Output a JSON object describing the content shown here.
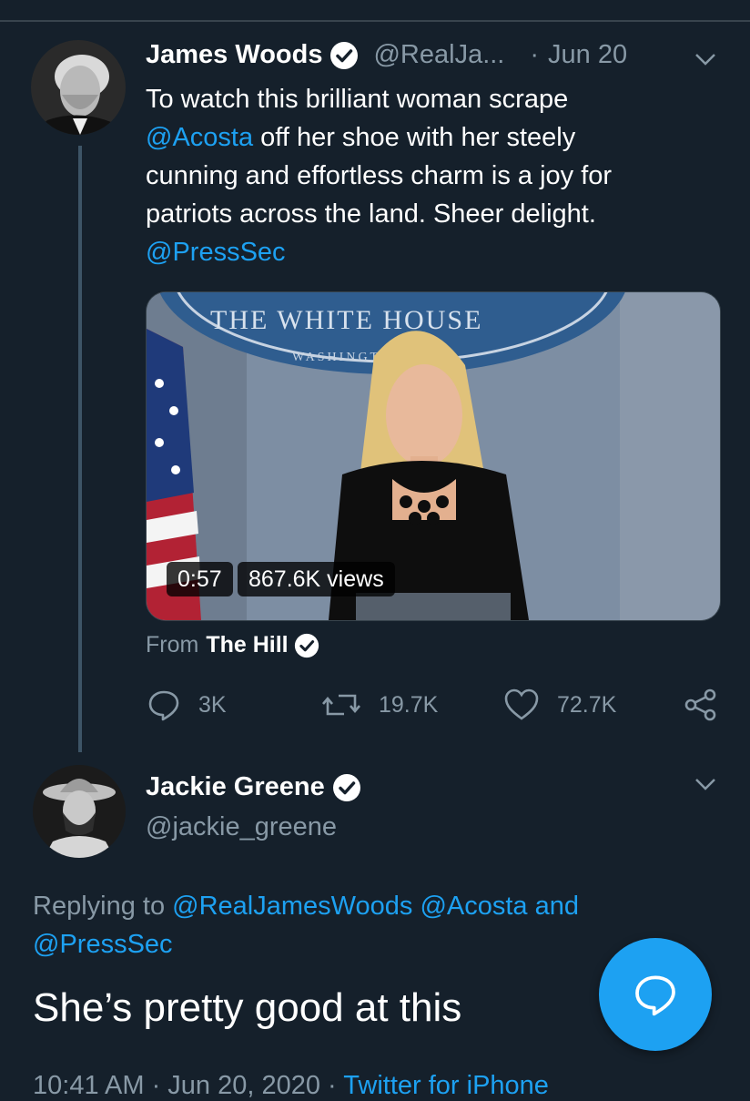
{
  "tweet": {
    "author_name": "James Woods",
    "author_handle": "@RealJa...",
    "separator": "·",
    "date": "Jun 20",
    "text_lines": [
      "To watch this brilliant woman scrape",
      " off her shoe with her steely",
      "cunning and effortless charm is a joy for",
      "patriots across the land. Sheer delight."
    ],
    "mention_acosta": "@Acosta",
    "mention_presssec": "@PressSec",
    "media": {
      "seal_text_top": "THE WHITE HOUSE",
      "seal_text_bottom": "WASHINGTON",
      "duration": "0:57",
      "views": "867.6K views"
    },
    "from_label": "From",
    "from_source": "The Hill",
    "actions": {
      "replies": "3K",
      "retweets": "19.7K",
      "likes": "72.7K"
    }
  },
  "reply": {
    "author_name": "Jackie Greene",
    "author_handle": "@jackie_greene",
    "replying_label": "Replying to",
    "replying_to_1": "@RealJamesWoods",
    "replying_to_2": "@Acosta",
    "replying_and": "and",
    "replying_to_3": "@PressSec",
    "text": "She’s pretty good at this",
    "meta_time": "10:41 AM · Jun 20, 2020 ·",
    "meta_source": "Twitter for iPhone"
  },
  "colors": {
    "background": "#15202b",
    "accent": "#1da1f2",
    "muted": "#8899a6"
  },
  "icons": {
    "verified": "verified-badge-icon",
    "chevron": "chevron-down-icon",
    "reply": "reply-icon",
    "retweet": "retweet-icon",
    "like": "heart-icon",
    "share": "share-icon",
    "compose": "compose-reply-icon"
  }
}
